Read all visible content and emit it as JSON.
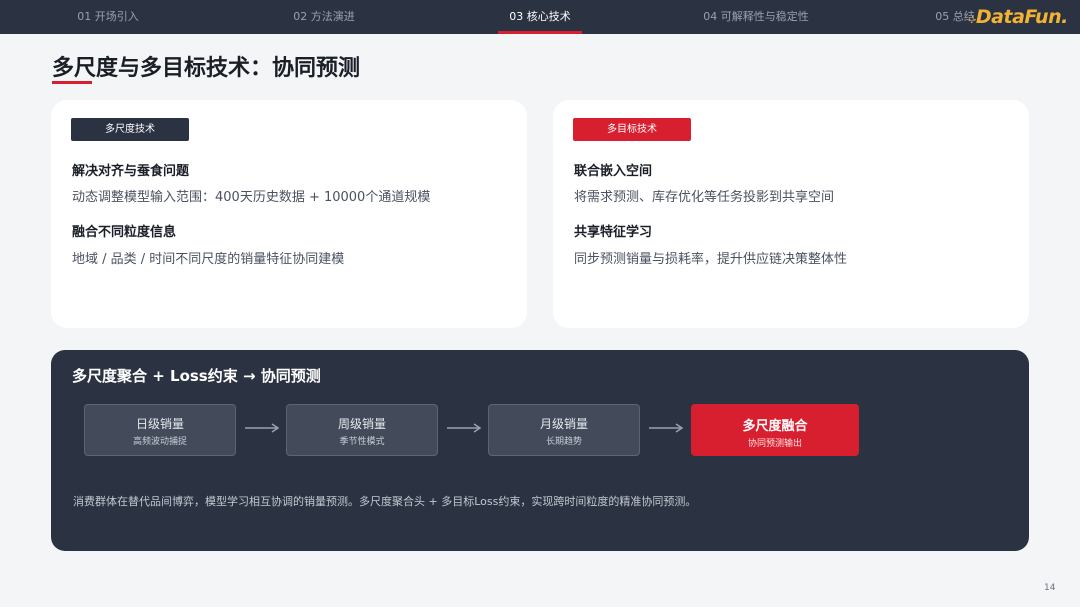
{
  "nav": {
    "tabs": [
      {
        "label": "01 开场引入"
      },
      {
        "label": "02 方法演进"
      },
      {
        "label": "03 核心技术"
      },
      {
        "label": "04 可解释性与稳定性"
      },
      {
        "label": "05 总结"
      }
    ],
    "active_index": 2,
    "logo_text": "DataFun."
  },
  "page": {
    "title": "多尺度与多目标技术：协同预测",
    "page_number": "14"
  },
  "cards": [
    {
      "tag": "多尺度技术",
      "items": [
        {
          "heading": "解决对齐与蚕食问题",
          "text": "动态调整模型输入范围：400天历史数据 + 10000个通道规模"
        },
        {
          "heading": "融合不同粒度信息",
          "text": "地域 / 品类 / 时间不同尺度的销量特征协同建模"
        }
      ]
    },
    {
      "tag": "多目标技术",
      "items": [
        {
          "heading": "联合嵌入空间",
          "text": "将需求预测、库存优化等任务投影到共享空间"
        },
        {
          "heading": "共享特征学习",
          "text": "同步预测销量与损耗率，提升供应链决策整体性"
        }
      ]
    }
  ],
  "flow": {
    "title": "多尺度聚合 + Loss约束 → 协同预测",
    "steps": [
      {
        "title": "日级销量",
        "sub": "高频波动捕捉"
      },
      {
        "title": "周级销量",
        "sub": "季节性模式"
      },
      {
        "title": "月级销量",
        "sub": "长期趋势"
      },
      {
        "title": "多尺度融合",
        "sub": "协同预测输出"
      }
    ],
    "description": "消费群体在替代品间博弈，模型学习相互协调的销量预测。多尺度聚合头 + 多目标Loss约束，实现跨时间粒度的精准协同预测。"
  },
  "colors": {
    "accent": "#d81f2f",
    "dark": "#2b3242",
    "logo": "#f2b233"
  }
}
